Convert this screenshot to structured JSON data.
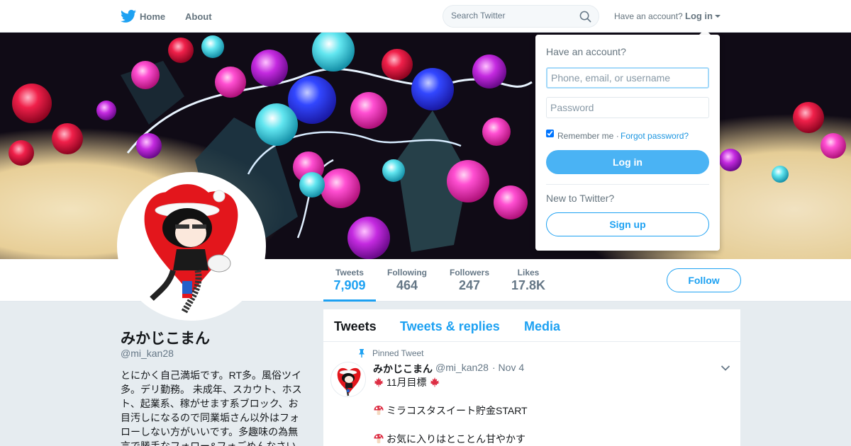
{
  "nav": {
    "home_label": "Home",
    "about_label": "About",
    "search_placeholder": "Search Twitter",
    "have_account_text": "Have an account?",
    "login_label": "Log in"
  },
  "profile": {
    "display_name": "みかじこまん",
    "handle": "@mi_kan28",
    "bio": "とにかく自己満垢です。RT多。風俗ツイ多。デリ勤務。 未成年、スカウト、ホスト、起業系、稼がせます系ブロック、お目汚しになるので同業垢さん以外はフォローしない方がいいです。多趣味の為無言で勝手なフォロー&フォごめんなさい",
    "follow_label": "Follow",
    "stats": [
      {
        "label": "Tweets",
        "value": "7,909"
      },
      {
        "label": "Following",
        "value": "464"
      },
      {
        "label": "Followers",
        "value": "247"
      },
      {
        "label": "Likes",
        "value": "17.8K"
      }
    ]
  },
  "timeline": {
    "tabs": [
      "Tweets",
      "Tweets & replies",
      "Media"
    ],
    "active_tab": "Tweets",
    "pinned_label": "Pinned Tweet",
    "tweet": {
      "author": "みかじこまん",
      "handle": "@mi_kan28",
      "date": "· Nov 4",
      "lines": [
        "11月目標",
        "ミラコスタスイート貯金START",
        "お気に入りはとことん甘やかす"
      ]
    }
  },
  "login_dropdown": {
    "heading": "Have an account?",
    "username_placeholder": "Phone, email, or username",
    "password_placeholder": "Password",
    "remember_label": "Remember me ·",
    "remember_checked": true,
    "forgot_label": "Forgot password?",
    "login_button": "Log in",
    "new_label": "New to Twitter?",
    "signup_button": "Sign up"
  },
  "colors": {
    "accent": "#1da1f2",
    "login_button_bg": "#4ab3f4",
    "page_bg": "#e6ecf0"
  },
  "icons": [
    "twitter-bird-icon",
    "search-icon",
    "caret-down-icon",
    "pin-icon",
    "chevron-down-icon",
    "maple-leaf-icon",
    "mushroom-icon"
  ]
}
